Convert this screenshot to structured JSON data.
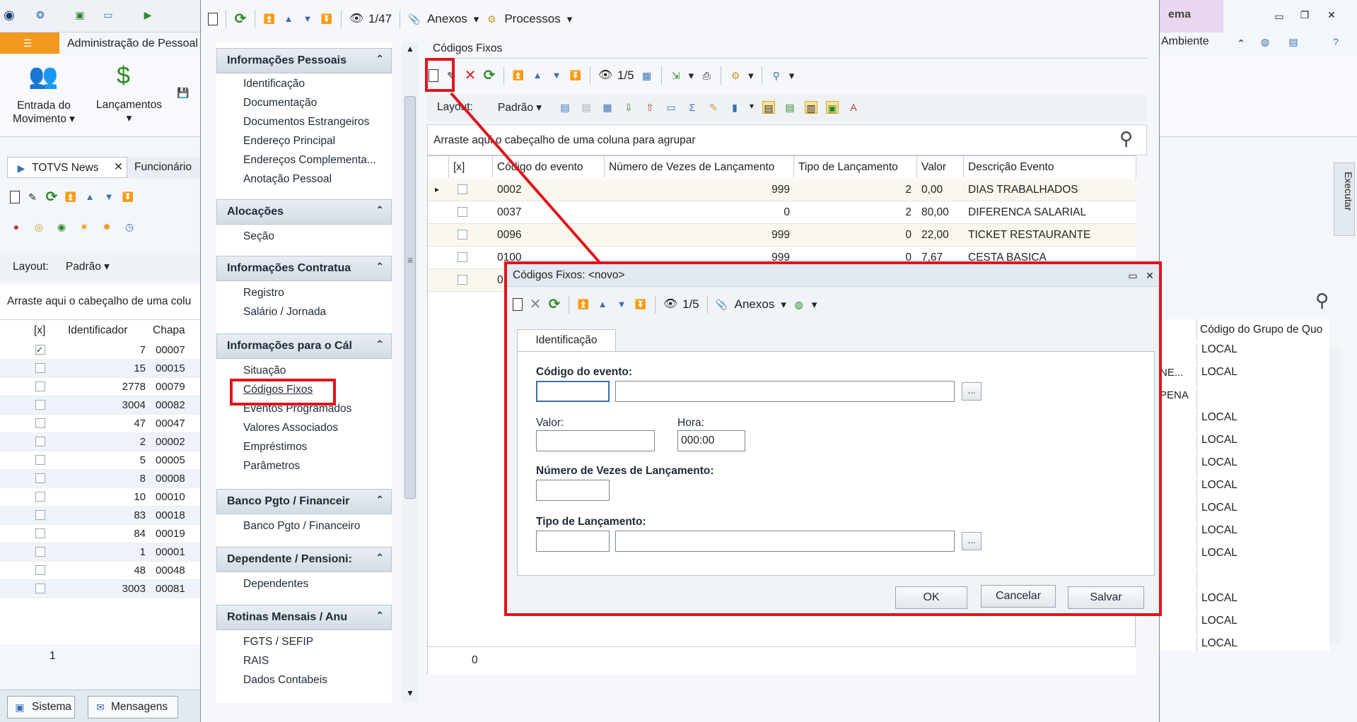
{
  "left_app": {
    "ribbon_tab": "Administração de Pessoal",
    "entrada_label_1": "Entrada do",
    "entrada_label_2": "Movimento",
    "lancamentos_label": "Lançamentos",
    "tab_news": "TOTVS News",
    "tab_funcionario": "Funcionário",
    "layout_label": "Layout:",
    "layout_value": "Padrão",
    "group_hint": "Arraste aqui o cabeçalho de uma colu",
    "columns": [
      "[x]",
      "Identificador",
      "Chapa"
    ],
    "rows": [
      {
        "id": "7",
        "chapa": "00007",
        "checked": true
      },
      {
        "id": "15",
        "chapa": "00015"
      },
      {
        "id": "2778",
        "chapa": "00079"
      },
      {
        "id": "3004",
        "chapa": "00082"
      },
      {
        "id": "47",
        "chapa": "00047"
      },
      {
        "id": "2",
        "chapa": "00002"
      },
      {
        "id": "5",
        "chapa": "00005"
      },
      {
        "id": "8",
        "chapa": "00008"
      },
      {
        "id": "10",
        "chapa": "00010"
      },
      {
        "id": "83",
        "chapa": "00018"
      },
      {
        "id": "84",
        "chapa": "00019"
      },
      {
        "id": "1",
        "chapa": "00001"
      },
      {
        "id": "48",
        "chapa": "00048"
      },
      {
        "id": "3003",
        "chapa": "00081"
      }
    ],
    "footer_count": "1",
    "status_sistema": "Sistema",
    "status_mensagens": "Mensagens"
  },
  "right_app": {
    "title_fragment": "ema",
    "ambiente": "Ambiente",
    "executar": "Executar",
    "column": "Código do Grupo de Quo",
    "rows": [
      "LOCAL",
      "LOCAL",
      "",
      "LOCAL",
      "LOCAL",
      "LOCAL",
      "LOCAL",
      "LOCAL",
      "LOCAL",
      "LOCAL",
      "",
      "LOCAL",
      "LOCAL",
      "LOCAL"
    ],
    "side_fragments": [
      "NE...",
      "PENA"
    ]
  },
  "main": {
    "record_counter": "1/47",
    "anexos": "Anexos",
    "processos": "Processos",
    "section_title": "Códigos Fixos",
    "grid_counter": "1/5",
    "layout_label": "Layout:",
    "layout_value": "Padrão",
    "group_hint": "Arraste aqui o cabeçalho de uma coluna para agrupar",
    "columns": [
      "[x]",
      "Código do evento",
      "Número de Vezes de Lançamento",
      "Tipo de Lançamento",
      "Valor",
      "Descrição Evento"
    ],
    "rows": [
      {
        "codigo": "0002",
        "vezes": "999",
        "tipo": "2",
        "valor": "0,00",
        "descricao": "DIAS TRABALHADOS"
      },
      {
        "codigo": "0037",
        "vezes": "0",
        "tipo": "2",
        "valor": "80,00",
        "descricao": "DIFERENCA SALARIAL"
      },
      {
        "codigo": "0096",
        "vezes": "999",
        "tipo": "0",
        "valor": "22,00",
        "descricao": "TICKET RESTAURANTE"
      },
      {
        "codigo": "0100",
        "vezes": "999",
        "tipo": "0",
        "valor": "7,67",
        "descricao": "CESTA BASICA"
      },
      {
        "codigo": "0"
      }
    ],
    "footer_count": "0"
  },
  "sidebar": {
    "groups": [
      {
        "title": "Informações Pessoais",
        "items": [
          "Identificação",
          "Documentação",
          "Documentos Estrangeiros",
          "Endereço Principal",
          "Endereços Complementa...",
          "Anotação Pessoal"
        ]
      },
      {
        "title": "Alocações",
        "items": [
          "Seção"
        ]
      },
      {
        "title": "Informações Contratua",
        "items": [
          "Registro",
          "Salário / Jornada"
        ]
      },
      {
        "title": "Informações para o Cál",
        "items": [
          "Situação",
          "Códigos Fixos",
          "Eventos Programados",
          "Valores Associados",
          "Empréstimos",
          "Parâmetros"
        ]
      },
      {
        "title": "Banco Pgto / Financeir",
        "items": [
          "Banco Pgto / Financeiro"
        ]
      },
      {
        "title": "Dependente / Pensioni:",
        "items": [
          "Dependentes"
        ]
      },
      {
        "title": "Rotinas Mensais / Anu",
        "items": [
          "FGTS / SEFIP",
          "RAIS",
          "Dados Contabeis"
        ]
      }
    ]
  },
  "dialog": {
    "title": "Códigos Fixos: <novo>",
    "counter": "1/5",
    "anexos": "Anexos",
    "tab": "Identificação",
    "codigo_label": "Código do evento:",
    "valor_label": "Valor:",
    "hora_label": "Hora:",
    "hora_value": "000:00",
    "vezes_label": "Número de Vezes de Lançamento:",
    "tipo_label": "Tipo de Lançamento:",
    "lookup": "...",
    "ok": "OK",
    "cancelar": "Cancelar",
    "salvar": "Salvar"
  },
  "colors": {
    "highlight": "#e0141b",
    "header_gradient": "#d4dbe4",
    "row_alt": "#eef3fb"
  }
}
